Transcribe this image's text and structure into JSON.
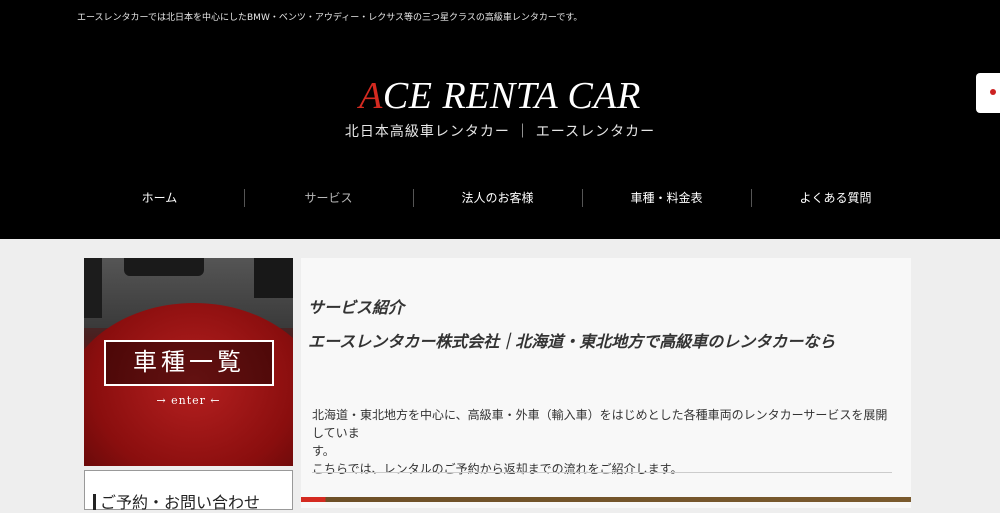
{
  "header": {
    "tagline": "エースレンタカーでは北日本を中心にしたBMW・ベンツ・アウディー・レクサス等の三つ星クラスの高級車レンタカーです。",
    "logo_accent": "A",
    "logo_rest": "CE RENTA CAR",
    "subtitle": "北日本高級車レンタカー ｜ エースレンタカー"
  },
  "nav": {
    "items": [
      {
        "label": "ホーム"
      },
      {
        "label": "サービス"
      },
      {
        "label": "法人のお客様"
      },
      {
        "label": "車種・料金表"
      },
      {
        "label": "よくある質問"
      }
    ],
    "current_index": 1
  },
  "sidebar": {
    "banner_title": "車種一覧",
    "banner_enter": "→ enter ←",
    "contact_label": "ご予約・お問い合わせ"
  },
  "main": {
    "heading": "サービス紹介",
    "subheading": "エースレンタカー株式会社｜北海道・東北地方で高級車のレンタカーなら",
    "paragraph_line1": "北海道・東北地方を中心に、高級車・外車（輸入車）をはじめとした各種車両のレンタカーサービスを展開していま",
    "paragraph_line1b": "す。",
    "paragraph_line2": "こちらでは、レンタルのご予約から返却までの流れをご紹介します。"
  },
  "colors": {
    "header_bg": "#000000",
    "accent_red": "#d42a20",
    "page_bg": "#eeeeee"
  }
}
